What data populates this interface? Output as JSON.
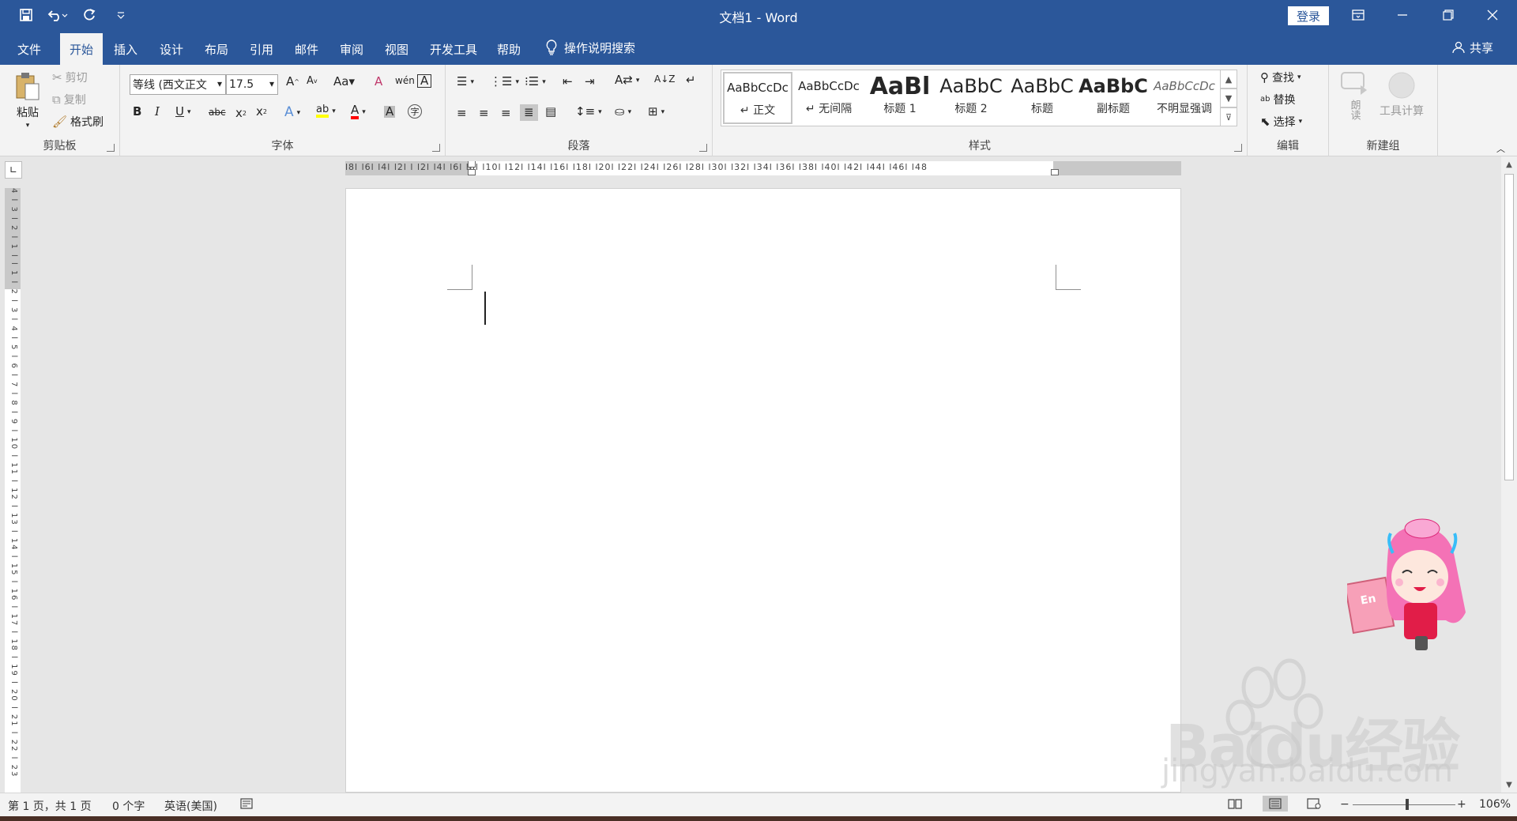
{
  "window": {
    "title": "文档1  -  Word",
    "login_label": "登录"
  },
  "tabs": [
    {
      "label": "文件"
    },
    {
      "label": "开始",
      "active": true
    },
    {
      "label": "插入"
    },
    {
      "label": "设计"
    },
    {
      "label": "布局"
    },
    {
      "label": "引用"
    },
    {
      "label": "邮件"
    },
    {
      "label": "审阅"
    },
    {
      "label": "视图"
    },
    {
      "label": "开发工具"
    },
    {
      "label": "帮助"
    }
  ],
  "tell_me": "操作说明搜索",
  "share_label": "共享",
  "clipboard": {
    "group_label": "剪贴板",
    "paste": "粘贴",
    "cut": "剪切",
    "copy": "复制",
    "format_painter": "格式刷"
  },
  "font": {
    "group_label": "字体",
    "font_name": "等线 (西文正文)",
    "font_size": "17.5"
  },
  "paragraph": {
    "group_label": "段落"
  },
  "styles": {
    "group_label": "样式",
    "items": [
      {
        "sample": "AaBbCcDc",
        "name": "↵ 正文"
      },
      {
        "sample": "AaBbCcDc",
        "name": "↵ 无间隔"
      },
      {
        "sample": "AaBl",
        "name": "标题 1"
      },
      {
        "sample": "AaBbC",
        "name": "标题 2"
      },
      {
        "sample": "AaBbC",
        "name": "标题"
      },
      {
        "sample": "AaBbC",
        "name": "副标题"
      },
      {
        "sample": "AaBbCcDc",
        "name": "不明显强调"
      }
    ]
  },
  "editing": {
    "group_label": "编辑",
    "find": "查找",
    "replace": "替换",
    "select": "选择"
  },
  "newgroup": {
    "group_label": "新建组",
    "read_aloud": "朗读",
    "tool_calc": "工具计算"
  },
  "ruler": {
    "horizontal": "l8l  l6l  l4l  l2l   l   l2l  l4l  l6l  l8l  l10l l12l l14l  l16l l18l l20l l22l l24l l26l l28l l30l l32l l34l l36l l38l l40l l42l l44l l46l l48",
    "vertical": "4 l 3 l 2 l 1 l   l 1 l 2 l 3 l 4 l 5 l 6 l 7 l 8 l 9 l 10 l 11 l 12 l 13 l 14 l 15 l 16 l 17 l 18 l 19 l 20 l 21 l 22 l 23"
  },
  "status": {
    "page": "第 1 页，共 1 页",
    "words": "0 个字",
    "language": "英语(美国)",
    "zoom": "106%",
    "zoom_fraction": 0.53
  },
  "watermark": {
    "brand": "Bai",
    "brand2": "du经验",
    "url": "jingyan.baidu.com"
  },
  "colors": {
    "accent": "#2b579a",
    "ribbon_bg": "#f3f3f3",
    "font_color": "#ff0000",
    "highlight": "#ffff00"
  }
}
